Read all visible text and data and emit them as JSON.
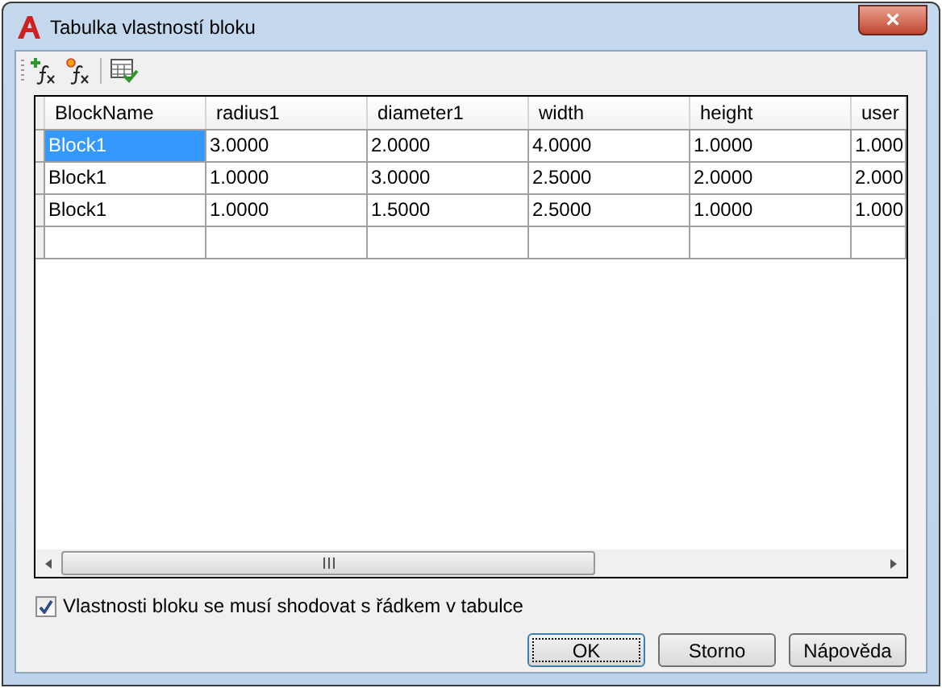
{
  "window": {
    "title": "Tabulka vlastností bloku",
    "close": "×"
  },
  "table": {
    "columns": [
      "BlockName",
      "radius1",
      "diameter1",
      "width",
      "height",
      "user"
    ],
    "rows": [
      {
        "name": "Block1",
        "selected": true,
        "values": [
          "3.0000",
          "2.0000",
          "4.0000",
          "1.0000",
          "1.000"
        ]
      },
      {
        "name": "Block1",
        "selected": false,
        "values": [
          "1.0000",
          "3.0000",
          "2.5000",
          "2.0000",
          "2.000"
        ]
      },
      {
        "name": "Block1",
        "selected": false,
        "values": [
          "1.0000",
          "1.5000",
          "2.5000",
          "1.0000",
          "1.000"
        ]
      }
    ]
  },
  "checkbox": {
    "label": "Vlastnosti bloku se musí shodovat s řádkem v tabulce",
    "checked": true
  },
  "buttons": [
    {
      "label": "OK",
      "default": true
    },
    {
      "label": "Storno",
      "default": false
    },
    {
      "label": "Nápověda",
      "default": false
    }
  ]
}
